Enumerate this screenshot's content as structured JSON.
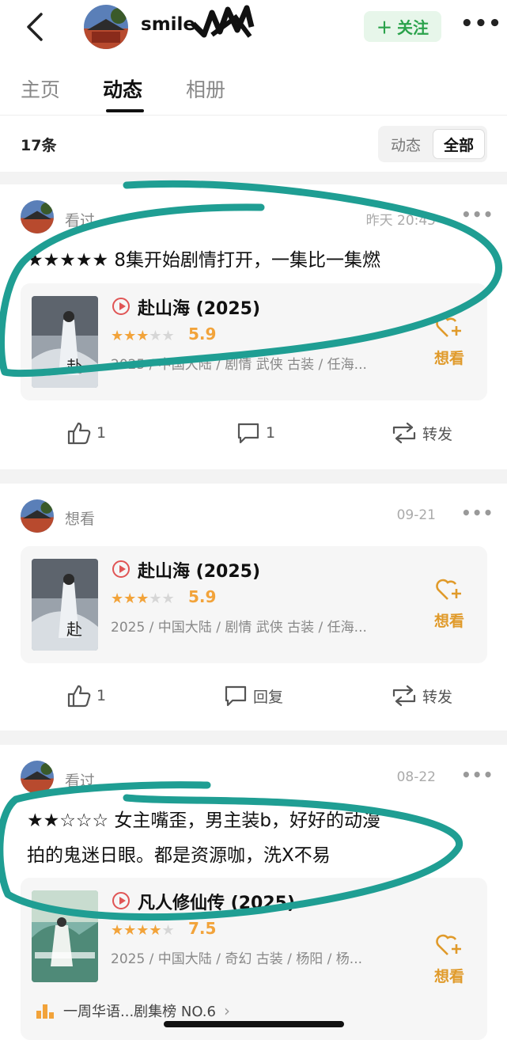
{
  "header": {
    "username": "smile",
    "follow_label": "关注",
    "follow_plus": "＋",
    "more_glyph": "•••"
  },
  "tabs": [
    {
      "label": "主页",
      "active": false
    },
    {
      "label": "动态",
      "active": true
    },
    {
      "label": "相册",
      "active": false
    }
  ],
  "count_text": "17条",
  "filter": {
    "options": [
      "动态",
      "全部"
    ],
    "selected": "全部"
  },
  "posts": [
    {
      "type": "看过",
      "time": "昨天 20:45",
      "text": "★★★★★ 8集开始剧情打开，一集比一集燃",
      "movie": {
        "title": "赴山海 (2025)",
        "stars_filled": 3,
        "stars_total": 5,
        "rating": "5.9",
        "info": "2025 / 中国大陆 / 剧情 武侠 古装 / 任海..."
      },
      "want_label": "想看",
      "actions": {
        "like": "1",
        "comment": "1",
        "share": "转发"
      }
    },
    {
      "type": "想看",
      "time": "09-21",
      "movie": {
        "title": "赴山海 (2025)",
        "stars_filled": 3,
        "stars_total": 5,
        "rating": "5.9",
        "info": "2025 / 中国大陆 / 剧情 武侠 古装 / 任海..."
      },
      "want_label": "想看",
      "actions": {
        "like": "1",
        "comment": "回复",
        "share": "转发"
      }
    },
    {
      "type": "看过",
      "time": "08-22",
      "text_line1": "★★☆☆☆ 女主嘴歪，男主装b，好好的动漫",
      "text_line2": "拍的鬼迷日眼。都是资源咖，洗X不易",
      "movie": {
        "title": "凡人修仙传 (2025)",
        "stars_filled": 4,
        "stars_total": 5,
        "rating": "7.5",
        "info": "2025 / 中国大陆 / 奇幻 古装 / 杨阳 / 杨..."
      },
      "want_label": "想看",
      "ranking": "一周华语...剧集榜 NO.6"
    }
  ],
  "colors": {
    "accent_green": "#2aa24b",
    "star_orange": "#f2a33a",
    "want_orange": "#e09a2a",
    "highlight_ink": "#1f9e93"
  }
}
